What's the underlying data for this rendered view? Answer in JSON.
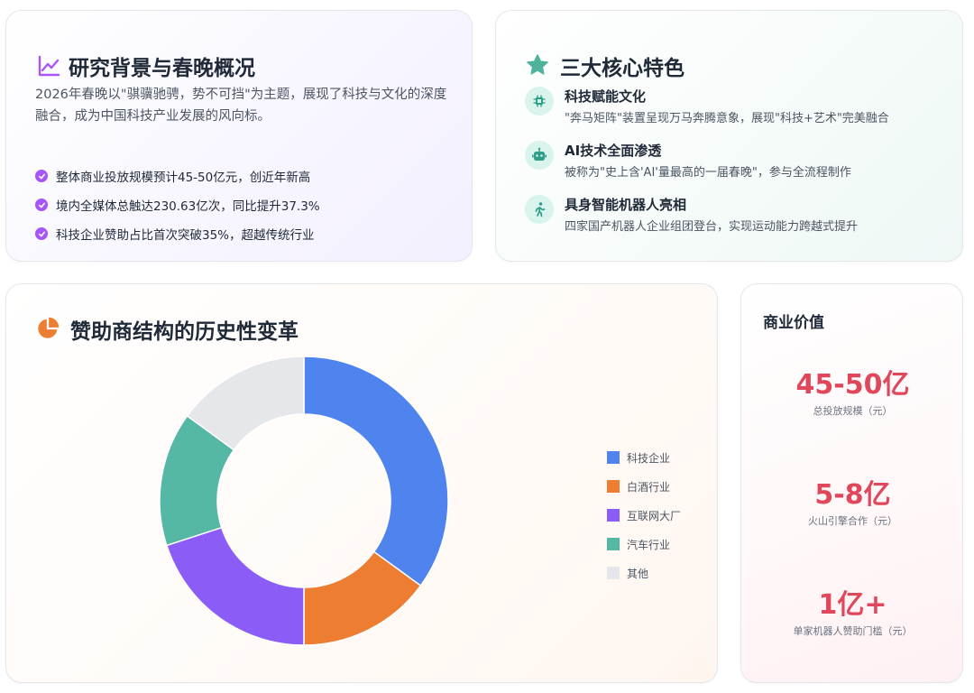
{
  "background_card": {
    "title": "研究背景与春晚概况",
    "intro": "2026年春晚以\"骐骥驰骋，势不可挡\"为主题，展现了科技与文化的深度融合，成为中国科技产业发展的风向标。",
    "bullets": [
      "整体商业投放规模预计45-50亿元，创近年新高",
      "境内全媒体总触达230.63亿次，同比提升37.3%",
      "科技企业赞助占比首次突破35%，超越传统行业"
    ]
  },
  "features_card": {
    "title": "三大核心特色",
    "items": [
      {
        "icon": "chip-icon",
        "title": "科技赋能文化",
        "desc": "\"奔马矩阵\"装置呈现万马奔腾意象，展现\"科技+艺术\"完美融合"
      },
      {
        "icon": "robot-icon",
        "title": "AI技术全面渗透",
        "desc": "被称为\"史上含'AI'量最高的一届春晚\"，参与全流程制作"
      },
      {
        "icon": "running-person-icon",
        "title": "具身智能机器人亮相",
        "desc": "四家国产机器人企业组团登台，实现运动能力跨越式提升"
      }
    ]
  },
  "chart_card": {
    "title": "赞助商结构的历史性变革"
  },
  "chart_data": {
    "type": "pie",
    "title": "赞助商结构的历史性变革",
    "categories": [
      "科技企业",
      "白酒行业",
      "互联网大厂",
      "汽车行业",
      "其他"
    ],
    "values": [
      35,
      15,
      20,
      15,
      15
    ],
    "colors": [
      "#4f84ee",
      "#ed7d31",
      "#8b5cf6",
      "#55b8a5",
      "#e5e7eb"
    ],
    "donut": true,
    "legend": "right"
  },
  "value_card": {
    "title": "商业价值",
    "metrics": [
      {
        "value": "45-50亿",
        "label": "总投放规模（元）"
      },
      {
        "value": "5-8亿",
        "label": "火山引擎合作（元）"
      },
      {
        "value": "1亿+",
        "label": "单家机器人赞助门槛（元）"
      }
    ]
  },
  "colors": {
    "accent_purple": "#a855f7",
    "accent_teal": "#4fb39c",
    "accent_orange": "#ed7d31",
    "metric_red": "#e0475b"
  }
}
